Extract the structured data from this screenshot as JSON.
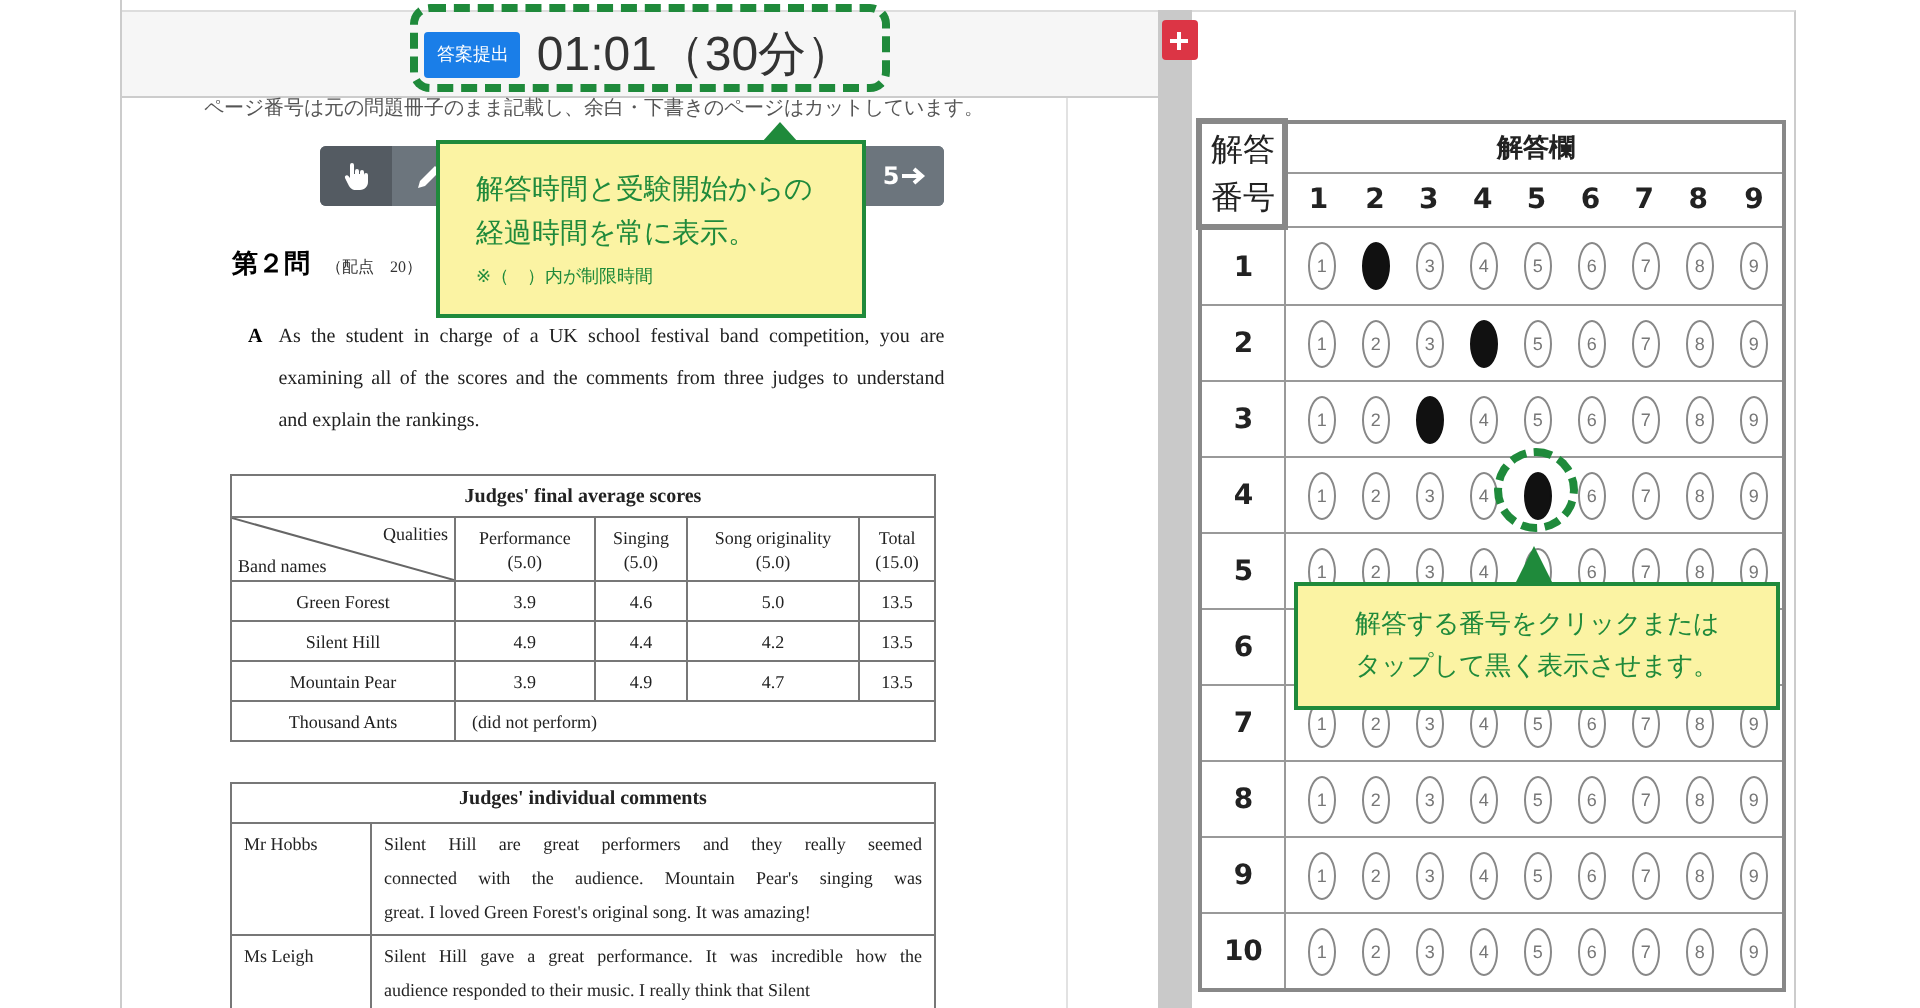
{
  "header": {
    "submit_button": "答案提出",
    "timer": "01:01（30分）"
  },
  "viewer": {
    "note": "ページ番号は元の問題冊子のまま記載し、余白・下書きのページはカットしています。",
    "toolbar": [
      {
        "kind": "hand",
        "selected": true
      },
      {
        "kind": "pencil",
        "selected": false
      },
      {
        "kind": "next",
        "label": "5"
      }
    ]
  },
  "document": {
    "heading": "第２問",
    "points": "（配点　20）",
    "intro_label": "A",
    "intro_lines": [
      "As the student in charge of a UK school festival band competition, you are",
      "examining all of the scores and the comments from three judges to understand",
      "and explain the rankings."
    ],
    "scores_table": {
      "title": "Judges' final average scores",
      "qualities_label": "Qualities",
      "bands_label": "Band names",
      "columns": [
        {
          "name": "Performance",
          "max": "(5.0)"
        },
        {
          "name": "Singing",
          "max": "(5.0)"
        },
        {
          "name": "Song originality",
          "max": "(5.0)"
        },
        {
          "name": "Total",
          "max": "(15.0)"
        }
      ],
      "rows": [
        {
          "band": "Green Forest",
          "scores": [
            "3.9",
            "4.6",
            "5.0",
            "13.5"
          ]
        },
        {
          "band": "Silent Hill",
          "scores": [
            "4.9",
            "4.4",
            "4.2",
            "13.5"
          ]
        },
        {
          "band": "Mountain Pear",
          "scores": [
            "3.9",
            "4.9",
            "4.7",
            "13.5"
          ]
        },
        {
          "band": "Thousand Ants",
          "note": "(did not perform)"
        }
      ]
    },
    "comments_table": {
      "title": "Judges' individual comments",
      "rows": [
        {
          "judge": "Mr Hobbs",
          "lines": [
            "Silent Hill are great performers and they really seemed",
            "connected with the audience.  Mountain Pear's singing was",
            "great.  I loved Green Forest's original song.  It was amazing!"
          ]
        },
        {
          "judge": "Ms Leigh",
          "lines": [
            "Silent Hill gave a great performance.  It was incredible how the",
            "audience responded to their music.  I really think that Silent"
          ]
        }
      ]
    }
  },
  "answer_sheet": {
    "number_header": "解答番号",
    "title": "解答欄",
    "choices": [
      "1",
      "2",
      "3",
      "4",
      "5",
      "6",
      "7",
      "8",
      "9"
    ],
    "rows": [
      {
        "number": "1",
        "bubbles": [
          {
            "label": "1"
          },
          {
            "selected": true
          },
          {
            "label": "3"
          },
          {
            "label": "4"
          },
          {
            "label": "5"
          },
          {
            "label": "6"
          },
          {
            "label": "7"
          },
          {
            "label": "8"
          },
          {
            "label": "9"
          }
        ]
      },
      {
        "number": "2",
        "bubbles": [
          {
            "label": "1"
          },
          {
            "label": "2"
          },
          {
            "label": "3"
          },
          {
            "selected": true
          },
          {
            "label": "5"
          },
          {
            "label": "6"
          },
          {
            "label": "7"
          },
          {
            "label": "8"
          },
          {
            "label": "9"
          }
        ]
      },
      {
        "number": "3",
        "bubbles": [
          {
            "label": "1"
          },
          {
            "label": "2"
          },
          {
            "selected": true
          },
          {
            "label": "4"
          },
          {
            "label": "5"
          },
          {
            "label": "6"
          },
          {
            "label": "7"
          },
          {
            "label": "8"
          },
          {
            "label": "9"
          }
        ]
      },
      {
        "number": "4",
        "bubbles": [
          {
            "label": "1"
          },
          {
            "label": "2"
          },
          {
            "label": "3"
          },
          {
            "label": "4"
          },
          {
            "selected": true
          },
          {
            "label": "6"
          },
          {
            "label": "7"
          },
          {
            "label": "8"
          },
          {
            "label": "9"
          }
        ]
      },
      {
        "number": "5",
        "bubbles": [
          {
            "label": "1"
          },
          {
            "label": "2"
          },
          {
            "label": "3"
          },
          {
            "label": "4"
          },
          {
            "selected": false
          },
          {
            "label": "6"
          },
          {
            "label": "7"
          },
          {
            "label": "8"
          },
          {
            "label": "9"
          }
        ]
      },
      {
        "number": "6"
      },
      {
        "number": "7",
        "bubbles": [
          {
            "label": "1"
          },
          {
            "label": "2"
          },
          {
            "label": "3"
          },
          {
            "label": "4"
          },
          {
            "label": "5"
          },
          {
            "label": "6"
          },
          {
            "label": "7"
          },
          {
            "label": "8"
          },
          {
            "label": "9"
          }
        ]
      },
      {
        "number": "8",
        "bubbles": [
          {
            "label": "1"
          },
          {
            "label": "2"
          },
          {
            "label": "3"
          },
          {
            "label": "4"
          },
          {
            "label": "5"
          },
          {
            "label": "6"
          },
          {
            "label": "7"
          },
          {
            "label": "8"
          },
          {
            "label": "9"
          }
        ]
      },
      {
        "number": "9",
        "bubbles": [
          {
            "label": "1"
          },
          {
            "label": "2"
          },
          {
            "label": "3"
          },
          {
            "label": "4"
          },
          {
            "label": "5"
          },
          {
            "label": "6"
          },
          {
            "label": "7"
          },
          {
            "label": "8"
          },
          {
            "label": "9"
          }
        ]
      },
      {
        "number": "10",
        "bubbles": [
          {
            "label": "1"
          },
          {
            "label": "2"
          },
          {
            "label": "3"
          },
          {
            "label": "4"
          },
          {
            "label": "5"
          },
          {
            "label": "6"
          },
          {
            "label": "7"
          },
          {
            "label": "8"
          },
          {
            "label": "9"
          }
        ]
      }
    ]
  },
  "callouts": [
    {
      "lines": [
        "解答時間と受験開始からの",
        "経過時間を常に表示。"
      ],
      "note": "※（　）内が制限時間"
    },
    {
      "lines": [
        "解答する番号をクリックまたは",
        "タップして黒く表示させます。"
      ]
    }
  ]
}
